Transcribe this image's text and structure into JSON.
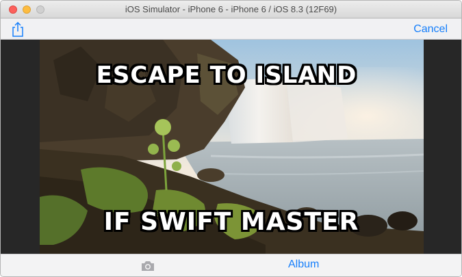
{
  "window": {
    "title": "iOS Simulator - iPhone 6 - iPhone 6 / iOS 8.3 (12F69)"
  },
  "navbar": {
    "share_icon": "share-icon",
    "cancel_label": "Cancel"
  },
  "photo": {
    "top_text": "ESCAPE TO ISLAND",
    "bottom_text": "IF SWIFT MASTER"
  },
  "toolbar": {
    "camera_icon": "camera-icon",
    "album_label": "Album"
  },
  "colors": {
    "accent": "#147efb",
    "content_background": "#272727",
    "bar_background": "#f1f1f3"
  }
}
